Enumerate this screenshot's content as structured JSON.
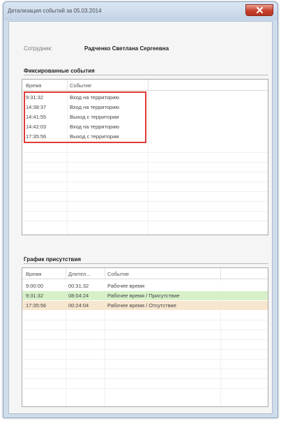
{
  "window": {
    "title": "Детализация событий за 05.03.2014"
  },
  "employee": {
    "label": "Сотрудник:",
    "name": "Радченко Светлана Сергеевна"
  },
  "fixed_events": {
    "title": "Фиксированные события",
    "columns": [
      "Время",
      "Событие"
    ],
    "rows": [
      {
        "time": "9:31:32",
        "event": "Вход на территорию"
      },
      {
        "time": "14:38:37",
        "event": "Вход на территорию"
      },
      {
        "time": "14:41:55",
        "event": "Выход с территории"
      },
      {
        "time": "14:42:03",
        "event": "Вход на территорию"
      },
      {
        "time": "17:35:56",
        "event": "Выход с территории"
      }
    ]
  },
  "presence": {
    "title": "График присутствия",
    "columns": [
      "Время",
      "Длител...",
      "Событие"
    ],
    "rows": [
      {
        "time": "9:00:00",
        "duration": "00:31:32",
        "event": "Рабочее время",
        "color": "#ffffff"
      },
      {
        "time": "9:31:32",
        "duration": "08:04:24",
        "event": "Рабочее время / Присутствие",
        "color": "#d7f0c8"
      },
      {
        "time": "17:35:56",
        "duration": "00:24:04",
        "event": "Рабочее время / Отсутствие",
        "color": "#f7e6cf"
      }
    ]
  },
  "colors": {
    "highlight_border": "#e03a3a",
    "close_button": "#c6412e",
    "presence_row": "#d7f0c8",
    "absence_row": "#f7e6cf"
  }
}
